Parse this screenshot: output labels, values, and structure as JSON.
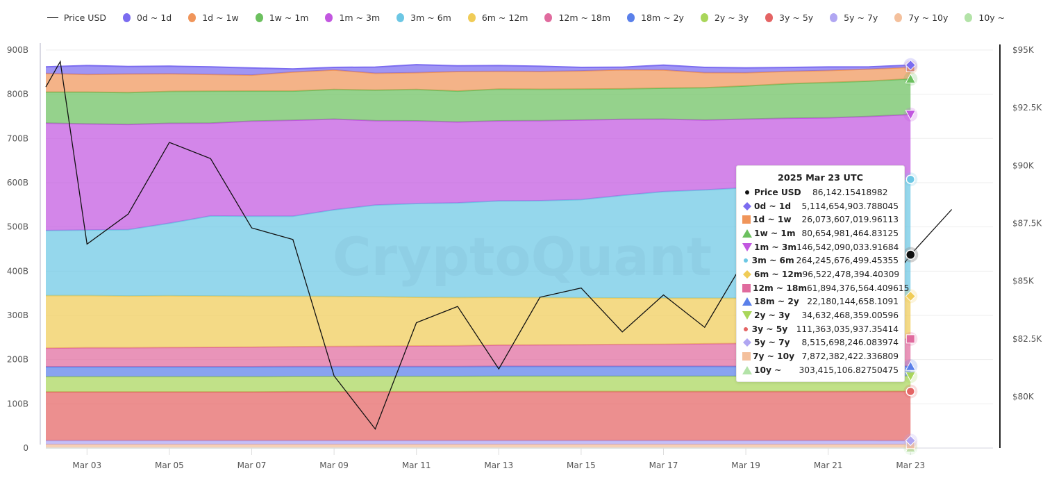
{
  "legend": [
    {
      "key": "price",
      "label": "Price USD",
      "type": "line",
      "color": "#111111"
    },
    {
      "key": "0d_1d",
      "label": "0d ~ 1d",
      "color": "#7b6cf0"
    },
    {
      "key": "1d_1w",
      "label": "1d ~ 1w",
      "color": "#f0955a"
    },
    {
      "key": "1w_1m",
      "label": "1w ~ 1m",
      "color": "#6cc05f"
    },
    {
      "key": "1m_3m",
      "label": "1m ~ 3m",
      "color": "#c257e0"
    },
    {
      "key": "3m_6m",
      "label": "3m ~ 6m",
      "color": "#6cc7e4"
    },
    {
      "key": "6m_12m",
      "label": "6m ~ 12m",
      "color": "#f0cc57"
    },
    {
      "key": "12m_18m",
      "label": "12m ~ 18m",
      "color": "#e06b9e"
    },
    {
      "key": "18m_2y",
      "label": "18m ~ 2y",
      "color": "#5a80ea"
    },
    {
      "key": "2y_3y",
      "label": "2y ~ 3y",
      "color": "#a9d65a"
    },
    {
      "key": "3y_5y",
      "label": "3y ~ 5y",
      "color": "#e46464"
    },
    {
      "key": "5y_7y",
      "label": "5y ~ 7y",
      "color": "#b0a6f2"
    },
    {
      "key": "7y_10y",
      "label": "7y ~ 10y",
      "color": "#f4c09c"
    },
    {
      "key": "10y_plus",
      "label": "10y ~",
      "color": "#b3e3a8"
    }
  ],
  "watermark": "CryptoQuant",
  "tooltip": {
    "title": "2025 Mar 23 UTC",
    "rows": [
      {
        "label": "Price USD",
        "value": "86,142.15418982",
        "marker": "dot-small",
        "color": "#111111"
      },
      {
        "label": "0d ~ 1d",
        "value": "5,114,654,903.788045",
        "marker": "diamond",
        "color": "#7b6cf0"
      },
      {
        "label": "1d ~ 1w",
        "value": "26,073,607,019.96113",
        "marker": "square",
        "color": "#f0955a"
      },
      {
        "label": "1w ~ 1m",
        "value": "80,654,981,464.83125",
        "marker": "triangle-up",
        "color": "#6cc05f"
      },
      {
        "label": "1m ~ 3m",
        "value": "146,542,090,033.91684",
        "marker": "triangle-down",
        "color": "#c257e0"
      },
      {
        "label": "3m ~ 6m",
        "value": "264,245,676,499.45355",
        "marker": "dot-small",
        "color": "#6cc7e4"
      },
      {
        "label": "6m ~ 12m",
        "value": "96,522,478,394.40309",
        "marker": "diamond",
        "color": "#f0cc57"
      },
      {
        "label": "12m ~ 18m",
        "value": "61,894,376,564.409615",
        "marker": "square",
        "color": "#e06b9e"
      },
      {
        "label": "18m ~ 2y",
        "value": "22,180,144,658.1091",
        "marker": "triangle-up",
        "color": "#5a80ea"
      },
      {
        "label": "2y ~ 3y",
        "value": "34,632,468,359.00596",
        "marker": "triangle-down",
        "color": "#a9d65a"
      },
      {
        "label": "3y ~ 5y",
        "value": "111,363,035,937.35414",
        "marker": "dot-small",
        "color": "#e46464"
      },
      {
        "label": "5y ~ 7y",
        "value": "8,515,698,246.083974",
        "marker": "diamond",
        "color": "#b0a6f2"
      },
      {
        "label": "7y ~ 10y",
        "value": "7,872,382,422.336809",
        "marker": "square",
        "color": "#f4c09c"
      },
      {
        "label": "10y ~",
        "value": "303,415,106.82750475",
        "marker": "triangle-up",
        "color": "#b3e3a8"
      }
    ]
  },
  "chart_data": {
    "type": "area",
    "stacked": true,
    "title": "",
    "xlabel": "",
    "ylabel_left": "",
    "ylabel_right": "",
    "x": [
      "Mar 02",
      "Mar 03",
      "Mar 04",
      "Mar 05",
      "Mar 06",
      "Mar 07",
      "Mar 08",
      "Mar 09",
      "Mar 10",
      "Mar 11",
      "Mar 12",
      "Mar 13",
      "Mar 14",
      "Mar 15",
      "Mar 16",
      "Mar 17",
      "Mar 18",
      "Mar 19",
      "Mar 20",
      "Mar 21",
      "Mar 22",
      "Mar 23"
    ],
    "x_tick_labels": [
      "Mar 03",
      "Mar 05",
      "Mar 07",
      "Mar 09",
      "Mar 11",
      "Mar 13",
      "Mar 15",
      "Mar 17",
      "Mar 19",
      "Mar 21",
      "Mar 23"
    ],
    "y_left": {
      "ticks": [
        "0",
        "100B",
        "200B",
        "300B",
        "400B",
        "500B",
        "600B",
        "700B",
        "800B",
        "900B"
      ],
      "range": [
        0,
        900
      ],
      "unit": "B"
    },
    "y_right": {
      "ticks": [
        "$80K",
        "$82.5K",
        "$85K",
        "$87.5K",
        "$90K",
        "$92.5K",
        "$95K"
      ],
      "range": [
        78000,
        95000
      ]
    },
    "grid": true,
    "legend_position": "top",
    "series_order_bottom_to_top": [
      "10y_plus",
      "7y_10y",
      "5y_7y",
      "3y_5y",
      "2y_3y",
      "18m_2y",
      "12m_18m",
      "6m_12m",
      "3m_6m",
      "1m_3m",
      "1w_1m",
      "1d_1w",
      "0d_1d"
    ],
    "series": [
      {
        "key": "10y_plus",
        "name": "10y ~",
        "values": [
          0.3,
          0.3,
          0.3,
          0.3,
          0.3,
          0.3,
          0.3,
          0.3,
          0.3,
          0.3,
          0.3,
          0.3,
          0.3,
          0.3,
          0.3,
          0.3,
          0.3,
          0.3,
          0.3,
          0.3,
          0.3,
          0.3
        ]
      },
      {
        "key": "7y_10y",
        "name": "7y ~ 10y",
        "values": [
          8,
          8,
          8,
          8,
          8,
          8,
          8,
          8,
          8,
          8,
          8,
          8,
          8,
          8,
          8,
          8,
          8,
          8,
          8,
          8,
          8,
          7.9
        ]
      },
      {
        "key": "5y_7y",
        "name": "5y ~ 7y",
        "values": [
          8.5,
          8.5,
          8.5,
          8.5,
          8.5,
          8.5,
          8.5,
          8.5,
          8.5,
          8.5,
          8.5,
          8.5,
          8.5,
          8.5,
          8.5,
          8.5,
          8.5,
          8.5,
          8.5,
          8.5,
          8.5,
          8.5
        ]
      },
      {
        "key": "3y_5y",
        "name": "3y ~ 5y",
        "values": [
          110,
          110,
          110,
          110,
          110,
          110,
          110.5,
          110.5,
          110.5,
          110.5,
          110.5,
          111,
          111,
          111,
          111,
          111,
          111,
          111,
          111,
          111,
          111.2,
          111.4
        ]
      },
      {
        "key": "2y_3y",
        "name": "2y ~ 3y",
        "values": [
          34.5,
          34.5,
          34.5,
          34.5,
          34.5,
          34.5,
          34.5,
          34.5,
          34.6,
          34.6,
          34.6,
          34.6,
          34.6,
          34.6,
          34.6,
          34.6,
          34.6,
          34.6,
          34.6,
          34.6,
          34.6,
          34.6
        ]
      },
      {
        "key": "18m_2y",
        "name": "18m ~ 2y",
        "values": [
          22.5,
          22.5,
          22.5,
          22.5,
          22.5,
          22.4,
          22.4,
          22.4,
          22.4,
          22.4,
          22.3,
          22.3,
          22.3,
          22.3,
          22.3,
          22.3,
          22.3,
          22.2,
          22.2,
          22.2,
          22.2,
          22.2
        ]
      },
      {
        "key": "12m_18m",
        "name": "12m ~ 18m",
        "values": [
          42,
          43,
          43,
          43.5,
          44,
          44.5,
          45,
          45.5,
          46,
          46.5,
          47,
          48,
          48.5,
          49,
          49.5,
          50,
          51,
          52,
          54,
          56,
          59,
          61.9
        ]
      },
      {
        "key": "6m_12m",
        "name": "6m ~ 12m",
        "values": [
          119,
          118,
          117,
          117,
          116,
          115,
          114,
          113,
          112,
          110,
          109,
          108,
          107,
          106,
          105,
          104,
          103,
          102,
          101,
          99,
          98,
          96.5
        ]
      },
      {
        "key": "3m_6m",
        "name": "3m ~ 6m",
        "values": [
          147,
          148,
          150,
          164,
          181,
          181,
          181,
          196,
          207,
          212,
          214,
          218,
          219,
          222,
          232,
          241,
          245,
          250,
          253,
          256,
          259,
          264.2
        ]
      },
      {
        "key": "1m_3m",
        "name": "1m ~ 3m",
        "values": [
          243,
          240,
          238,
          226,
          210,
          215,
          217,
          205,
          191,
          187,
          183,
          181,
          181,
          180,
          172,
          164,
          158,
          155,
          153,
          151,
          149,
          146.5
        ]
      },
      {
        "key": "1w_1m",
        "name": "1w ~ 1m",
        "values": [
          70,
          72,
          72,
          72,
          72,
          68,
          66,
          67,
          69,
          71,
          70,
          72,
          71,
          70,
          69,
          70,
          73,
          75,
          78,
          80,
          80,
          80.7
        ]
      },
      {
        "key": "1d_1w",
        "name": "1d ~ 1w",
        "values": [
          42,
          40,
          42,
          40,
          38,
          36,
          43,
          44,
          38,
          38,
          44,
          40,
          40,
          41,
          43,
          41,
          34,
          30,
          28,
          27,
          27,
          26.1
        ]
      },
      {
        "key": "0d_1d",
        "name": "0d ~ 1d",
        "values": [
          15,
          20,
          17,
          17,
          17,
          16,
          7,
          6,
          14,
          18,
          13,
          13,
          12,
          8,
          6,
          11,
          12,
          11,
          9,
          8,
          5,
          5.1
        ]
      }
    ],
    "price_series": {
      "name": "Price USD",
      "x": [
        "Mar 02",
        "Mar 02.35",
        "Mar 03",
        "Mar 04",
        "Mar 05",
        "Mar 06",
        "Mar 07",
        "Mar 08",
        "Mar 09",
        "Mar 10",
        "Mar 11",
        "Mar 12",
        "Mar 13",
        "Mar 14",
        "Mar 15",
        "Mar 16",
        "Mar 17",
        "Mar 18",
        "Mar 19",
        "Mar 20",
        "Mar 21",
        "Mar 22",
        "Mar 23",
        "Mar 24"
      ],
      "values": [
        93400,
        94500,
        86600,
        87900,
        91000,
        90300,
        87300,
        86800,
        80900,
        78600,
        83200,
        83900,
        81200,
        84300,
        84700,
        82800,
        84400,
        83000,
        86000,
        84200,
        84000,
        83700,
        86142.15,
        88100
      ]
    },
    "highlight": {
      "x": "Mar 23"
    }
  }
}
